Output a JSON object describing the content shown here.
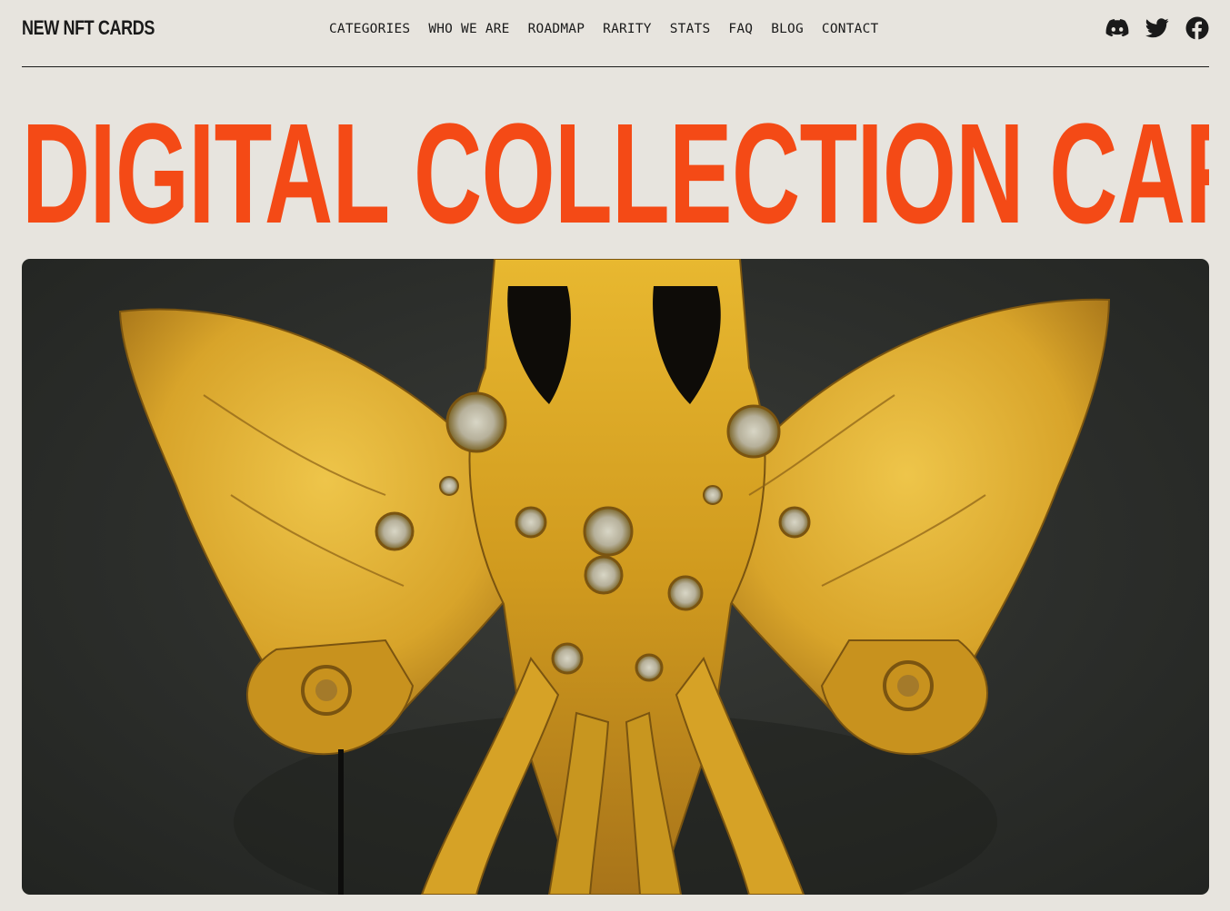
{
  "header": {
    "logo": "NEW NFT CARDS",
    "nav": [
      "CATEGORIES",
      "WHO WE ARE",
      "ROADMAP",
      "RARITY",
      "STATS",
      "FAQ",
      "BLOG",
      "CONTACT"
    ],
    "social": [
      {
        "name": "discord",
        "icon": "discord-icon"
      },
      {
        "name": "twitter",
        "icon": "twitter-icon"
      },
      {
        "name": "facebook",
        "icon": "facebook-icon"
      }
    ]
  },
  "hero": {
    "title": "DIGITAL COLLECTION CARDS",
    "image_subject": "yellow winged sculpture"
  },
  "colors": {
    "background": "#e7e4de",
    "accent": "#f44a16",
    "text": "#1a1a1a"
  }
}
